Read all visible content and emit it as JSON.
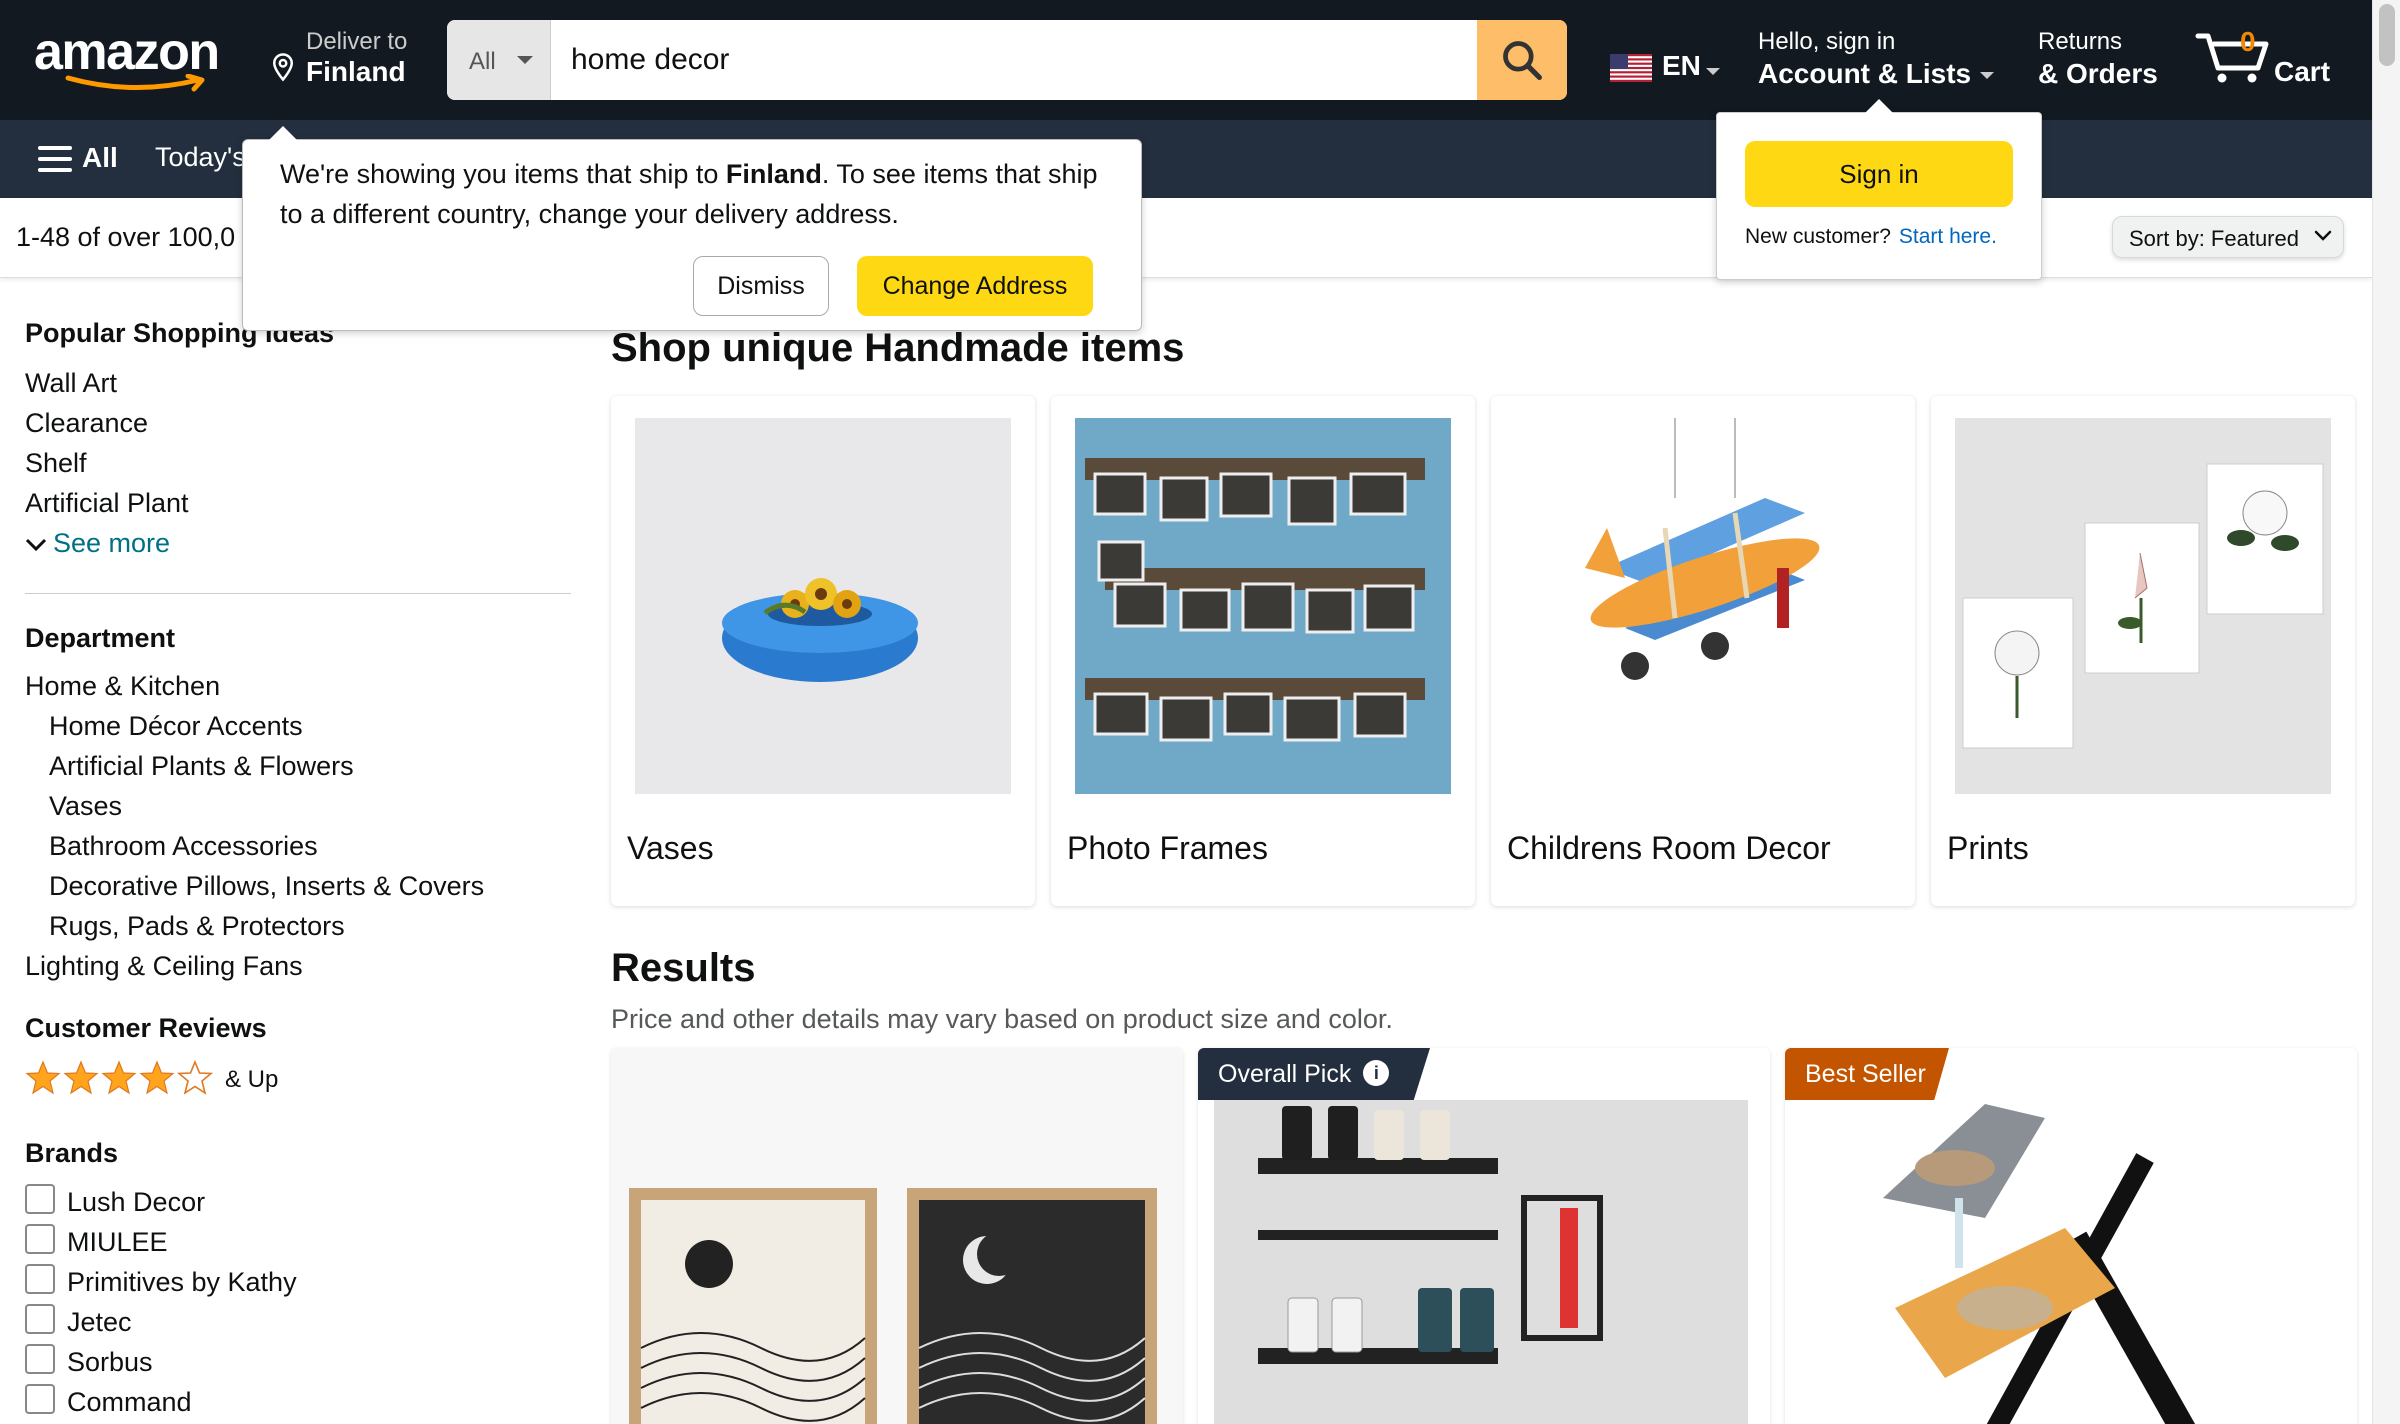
{
  "header": {
    "logo_text": "amazon",
    "deliver_line1": "Deliver to",
    "deliver_line2": "Finland",
    "search_category": "All",
    "search_value": "home decor",
    "language": "EN",
    "account_line1": "Hello, sign in",
    "account_line2": "Account & Lists",
    "orders_line1": "Returns",
    "orders_line2": "& Orders",
    "cart_count": "0",
    "cart_label": "Cart"
  },
  "nav": {
    "all_label": "All",
    "deals_label": "Today's"
  },
  "results_bar": {
    "count_text": "1-48 of over 100,0",
    "sort_label": "Sort by:  Featured"
  },
  "country_popup": {
    "msg_part1": "We're showing you items that ship to ",
    "msg_country": "Finland",
    "msg_part2": ". To see items that ship to a different country, change your delivery address.",
    "dismiss_label": "Dismiss",
    "change_label": "Change Address"
  },
  "signin_popup": {
    "button_label": "Sign in",
    "new_customer": "New customer?",
    "start_here": "Start here."
  },
  "sidebar": {
    "popular_title": "Popular Shopping Ideas",
    "popular_items": [
      "Wall Art",
      "Clearance",
      "Shelf",
      "Artificial Plant"
    ],
    "see_more": "See more",
    "department_title": "Department",
    "department_root": "Home & Kitchen",
    "department_subs": [
      "Home Décor Accents",
      "Artificial Plants & Flowers",
      "Vases",
      "Bathroom Accessories",
      "Decorative Pillows, Inserts & Covers",
      "Rugs, Pads & Protectors"
    ],
    "department_other": "Lighting & Ceiling Fans",
    "reviews_title": "Customer Reviews",
    "reviews_rating": 4,
    "reviews_suffix": "& Up",
    "brands_title": "Brands",
    "brands": [
      "Lush Decor",
      "MIULEE",
      "Primitives by Kathy",
      "Jetec",
      "Sorbus",
      "Command"
    ]
  },
  "handmade": {
    "title": "Shop unique Handmade items",
    "cards": [
      {
        "label": "Vases"
      },
      {
        "label": "Photo Frames"
      },
      {
        "label": "Childrens Room Decor"
      },
      {
        "label": "Prints"
      }
    ]
  },
  "results": {
    "title": "Results",
    "subtitle": "Price and other details may vary based on product size and color.",
    "badge_overall": "Overall Pick",
    "badge_best": "Best Seller"
  },
  "colors": {
    "nav_dark": "#131921",
    "nav_secondary": "#232f3e",
    "search_button": "#febd69",
    "yellow_button": "#ffd814",
    "link": "#007185",
    "star": "#ffa41c",
    "best_seller": "#c45500"
  }
}
